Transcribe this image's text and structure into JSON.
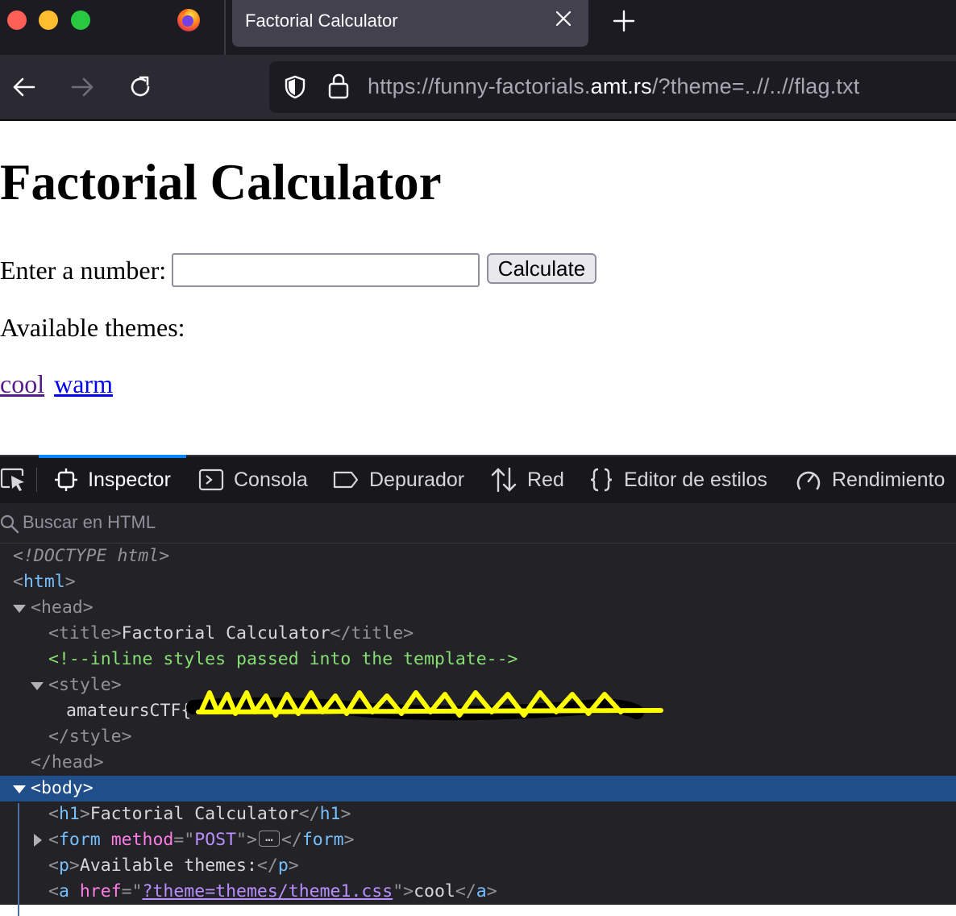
{
  "browser": {
    "tab_title": "Factorial Calculator",
    "url": {
      "prefix": "https://funny-factorials.",
      "host": "amt.rs",
      "path": "/?theme=..//..//flag.txt"
    }
  },
  "page": {
    "heading": "Factorial Calculator",
    "input_label": "Enter a number:",
    "input_value": "",
    "button_label": "Calculate",
    "themes_label": "Available themes:",
    "theme_links": [
      "cool",
      "warm"
    ]
  },
  "devtools": {
    "tabs": [
      "Inspector",
      "Consola",
      "Depurador",
      "Red",
      "Editor de estilos",
      "Rendimiento"
    ],
    "selected_tab": "Inspector",
    "search_placeholder": "Buscar en HTML",
    "tree": {
      "doctype": "<!DOCTYPE html>",
      "html_tag": "html",
      "head_tag": "head",
      "title_tag": "title",
      "title_text": "Factorial Calculator",
      "comment": "<!--inline styles passed into the template-->",
      "style_tag": "style",
      "style_text_visible": "amateursCTF{",
      "body_tag": "body",
      "h1_tag": "h1",
      "h1_text": "Factorial Calculator",
      "form_tag": "form",
      "form_attr_name": "method",
      "form_attr_value": "POST",
      "p_tag": "p",
      "p_text": "Available themes:",
      "a_tag": "a",
      "a_attr_name": "href",
      "a_attr_value": "?theme=themes/theme1.css",
      "a_text": "cool"
    }
  },
  "colors": {
    "accent": "#0a84ff",
    "selected_row": "#204e8a",
    "redaction": "#ffff00"
  }
}
